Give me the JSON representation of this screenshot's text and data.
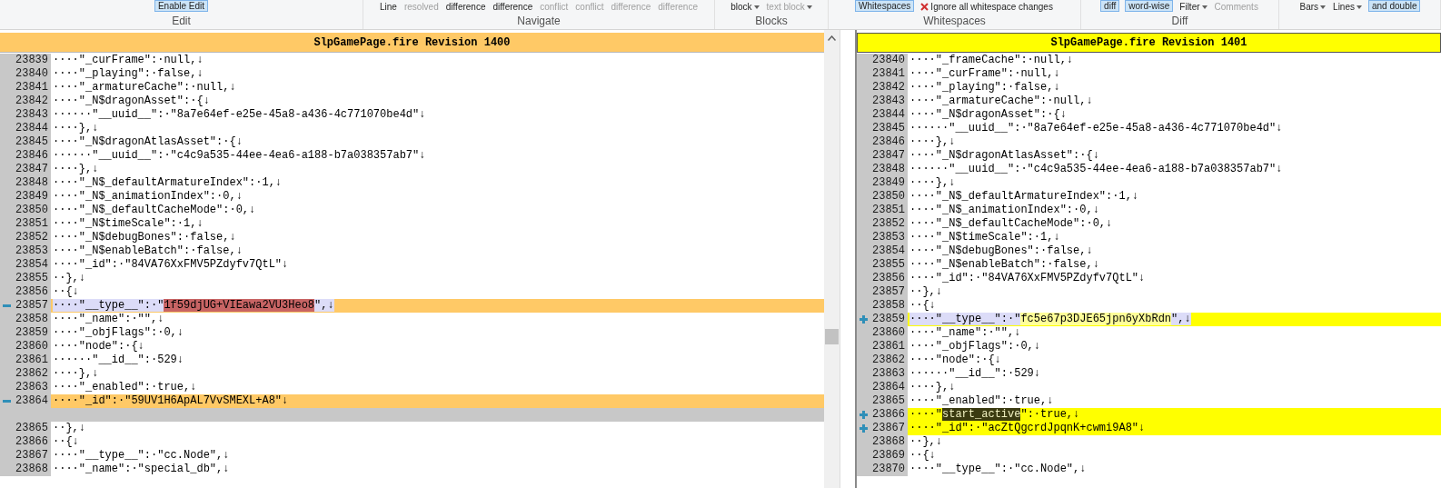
{
  "ribbon": {
    "groups": [
      {
        "label": "Edit",
        "items": [
          {
            "label": "Enable Edit",
            "kind": "button",
            "selected": true,
            "disabled": false
          }
        ]
      },
      {
        "label": "Navigate",
        "items": [
          {
            "label": "Line",
            "kind": "text",
            "selected": false,
            "disabled": false
          },
          {
            "label": "resolved",
            "kind": "text",
            "selected": false,
            "disabled": true
          },
          {
            "label": "difference",
            "kind": "text",
            "selected": false,
            "disabled": false
          },
          {
            "label": "difference",
            "kind": "text",
            "selected": false,
            "disabled": false
          },
          {
            "label": "conflict",
            "kind": "text",
            "selected": false,
            "disabled": true
          },
          {
            "label": "conflict",
            "kind": "text",
            "selected": false,
            "disabled": true
          },
          {
            "label": "difference",
            "kind": "text",
            "selected": false,
            "disabled": true
          },
          {
            "label": "difference",
            "kind": "text",
            "selected": false,
            "disabled": true
          }
        ]
      },
      {
        "label": "Blocks",
        "items": [
          {
            "label": "block",
            "kind": "dropdown",
            "selected": false,
            "disabled": false
          },
          {
            "label": "text block",
            "kind": "dropdown",
            "selected": false,
            "disabled": true
          }
        ]
      },
      {
        "label": "Whitespaces",
        "items": [
          {
            "label": "Whitespaces",
            "kind": "button",
            "selected": true,
            "disabled": false
          },
          {
            "label": "Ignore all whitespace changes",
            "kind": "toggle",
            "selected": false,
            "disabled": false
          }
        ]
      },
      {
        "label": "Diff",
        "items": [
          {
            "label": "diff",
            "kind": "button",
            "selected": true,
            "disabled": false
          },
          {
            "label": "word-wise",
            "kind": "button",
            "selected": true,
            "disabled": false
          },
          {
            "label": "Filter",
            "kind": "dropdown",
            "selected": false,
            "disabled": false
          },
          {
            "label": "Comments",
            "kind": "text",
            "selected": false,
            "disabled": true
          }
        ]
      },
      {
        "items": [
          {
            "label": "Bars",
            "kind": "dropdown",
            "selected": false,
            "disabled": false
          },
          {
            "label": "Lines",
            "kind": "dropdown",
            "selected": false,
            "disabled": false
          },
          {
            "label": "and double",
            "kind": "button",
            "selected": true,
            "disabled": false
          }
        ]
      }
    ]
  },
  "panes": [
    {
      "title": "SlpGamePage.fire Revision 1400",
      "lines": [
        {
          "num": "23839",
          "kind": "normal",
          "segments": [
            {
              "text": "····\"_curFrame\":·null,↓",
              "kind": "plain"
            }
          ]
        },
        {
          "num": "23840",
          "kind": "normal",
          "segments": [
            {
              "text": "····\"_playing\":·false,↓",
              "kind": "plain"
            }
          ]
        },
        {
          "num": "23841",
          "kind": "normal",
          "segments": [
            {
              "text": "····\"_armatureCache\":·null,↓",
              "kind": "plain"
            }
          ]
        },
        {
          "num": "23842",
          "kind": "normal",
          "segments": [
            {
              "text": "····\"_N$dragonAsset\":·{↓",
              "kind": "plain"
            }
          ]
        },
        {
          "num": "23843",
          "kind": "normal",
          "segments": [
            {
              "text": "······\"__uuid__\":·\"8a7e64ef-e25e-45a8-a436-4c771070be4d\"↓",
              "kind": "plain"
            }
          ]
        },
        {
          "num": "23844",
          "kind": "normal",
          "segments": [
            {
              "text": "····},↓",
              "kind": "plain"
            }
          ]
        },
        {
          "num": "23845",
          "kind": "normal",
          "segments": [
            {
              "text": "····\"_N$dragonAtlasAsset\":·{↓",
              "kind": "plain"
            }
          ]
        },
        {
          "num": "23846",
          "kind": "normal",
          "segments": [
            {
              "text": "······\"__uuid__\":·\"c4c9a535-44ee-4ea6-a188-b7a038357ab7\"↓",
              "kind": "plain"
            }
          ]
        },
        {
          "num": "23847",
          "kind": "normal",
          "segments": [
            {
              "text": "····},↓",
              "kind": "plain"
            }
          ]
        },
        {
          "num": "23848",
          "kind": "normal",
          "segments": [
            {
              "text": "····\"_N$_defaultArmatureIndex\":·1,↓",
              "kind": "plain"
            }
          ]
        },
        {
          "num": "23849",
          "kind": "normal",
          "segments": [
            {
              "text": "····\"_N$_animationIndex\":·0,↓",
              "kind": "plain"
            }
          ]
        },
        {
          "num": "23850",
          "kind": "normal",
          "segments": [
            {
              "text": "····\"_N$_defaultCacheMode\":·0,↓",
              "kind": "plain"
            }
          ]
        },
        {
          "num": "23851",
          "kind": "normal",
          "segments": [
            {
              "text": "····\"_N$timeScale\":·1,↓",
              "kind": "plain"
            }
          ]
        },
        {
          "num": "23852",
          "kind": "normal",
          "segments": [
            {
              "text": "····\"_N$debugBones\":·false,↓",
              "kind": "plain"
            }
          ]
        },
        {
          "num": "23853",
          "kind": "normal",
          "segments": [
            {
              "text": "····\"_N$enableBatch\":·false,↓",
              "kind": "plain"
            }
          ]
        },
        {
          "num": "23854",
          "kind": "normal",
          "segments": [
            {
              "text": "····\"_id\":·\"84VA76XxFMV5PZdyfv7QtL\"↓",
              "kind": "plain"
            }
          ]
        },
        {
          "num": "23855",
          "kind": "normal",
          "segments": [
            {
              "text": "··},↓",
              "kind": "plain"
            }
          ]
        },
        {
          "num": "23856",
          "kind": "normal",
          "segments": [
            {
              "text": "··{↓",
              "kind": "plain"
            }
          ]
        },
        {
          "num": "23857",
          "kind": "removed",
          "segments": [
            {
              "text": "····\"__type__\":·\"",
              "kind": "moved"
            },
            {
              "text": "1f59djUG+VIEawa2VU3Heo8",
              "kind": "changed"
            },
            {
              "text": "\",↓",
              "kind": "moved"
            }
          ]
        },
        {
          "num": "23858",
          "kind": "normal",
          "segments": [
            {
              "text": "····\"_name\":·\"\",↓",
              "kind": "plain"
            }
          ]
        },
        {
          "num": "23859",
          "kind": "normal",
          "segments": [
            {
              "text": "····\"_objFlags\":·0,↓",
              "kind": "plain"
            }
          ]
        },
        {
          "num": "23860",
          "kind": "normal",
          "segments": [
            {
              "text": "····\"node\":·{↓",
              "kind": "plain"
            }
          ]
        },
        {
          "num": "23861",
          "kind": "normal",
          "segments": [
            {
              "text": "······\"__id__\":·529↓",
              "kind": "plain"
            }
          ]
        },
        {
          "num": "23862",
          "kind": "normal",
          "segments": [
            {
              "text": "····},↓",
              "kind": "plain"
            }
          ]
        },
        {
          "num": "23863",
          "kind": "normal",
          "segments": [
            {
              "text": "····\"_enabled\":·true,↓",
              "kind": "plain"
            }
          ]
        },
        {
          "num": "23864",
          "kind": "removed",
          "segments": [
            {
              "text": "····\"_id\":·\"59UV1H6ApAL7VvSMEXL+A8\"↓",
              "kind": "plain"
            }
          ]
        },
        {
          "kind": "filler"
        },
        {
          "num": "23865",
          "kind": "normal",
          "segments": [
            {
              "text": "··},↓",
              "kind": "plain"
            }
          ]
        },
        {
          "num": "23866",
          "kind": "normal",
          "segments": [
            {
              "text": "··{↓",
              "kind": "plain"
            }
          ]
        },
        {
          "num": "23867",
          "kind": "normal",
          "segments": [
            {
              "text": "····\"__type__\":·\"cc.Node\",↓",
              "kind": "plain"
            }
          ]
        },
        {
          "num": "23868",
          "kind": "normal",
          "segments": [
            {
              "text": "····\"_name\":·\"special_db\",↓",
              "kind": "plain"
            }
          ]
        }
      ]
    },
    {
      "title": "SlpGamePage.fire Revision 1401",
      "lines": [
        {
          "num": "23840",
          "kind": "normal",
          "segments": [
            {
              "text": "····\"_frameCache\":·null,↓",
              "kind": "plain"
            }
          ]
        },
        {
          "num": "23841",
          "kind": "normal",
          "segments": [
            {
              "text": "····\"_curFrame\":·null,↓",
              "kind": "plain"
            }
          ]
        },
        {
          "num": "23842",
          "kind": "normal",
          "segments": [
            {
              "text": "····\"_playing\":·false,↓",
              "kind": "plain"
            }
          ]
        },
        {
          "num": "23843",
          "kind": "normal",
          "segments": [
            {
              "text": "····\"_armatureCache\":·null,↓",
              "kind": "plain"
            }
          ]
        },
        {
          "num": "23844",
          "kind": "normal",
          "segments": [
            {
              "text": "····\"_N$dragonAsset\":·{↓",
              "kind": "plain"
            }
          ]
        },
        {
          "num": "23845",
          "kind": "normal",
          "segments": [
            {
              "text": "······\"__uuid__\":·\"8a7e64ef-e25e-45a8-a436-4c771070be4d\"↓",
              "kind": "plain"
            }
          ]
        },
        {
          "num": "23846",
          "kind": "normal",
          "segments": [
            {
              "text": "····},↓",
              "kind": "plain"
            }
          ]
        },
        {
          "num": "23847",
          "kind": "normal",
          "segments": [
            {
              "text": "····\"_N$dragonAtlasAsset\":·{↓",
              "kind": "plain"
            }
          ]
        },
        {
          "num": "23848",
          "kind": "normal",
          "segments": [
            {
              "text": "······\"__uuid__\":·\"c4c9a535-44ee-4ea6-a188-b7a038357ab7\"↓",
              "kind": "plain"
            }
          ]
        },
        {
          "num": "23849",
          "kind": "normal",
          "segments": [
            {
              "text": "····},↓",
              "kind": "plain"
            }
          ]
        },
        {
          "num": "23850",
          "kind": "normal",
          "segments": [
            {
              "text": "····\"_N$_defaultArmatureIndex\":·1,↓",
              "kind": "plain"
            }
          ]
        },
        {
          "num": "23851",
          "kind": "normal",
          "segments": [
            {
              "text": "····\"_N$_animationIndex\":·0,↓",
              "kind": "plain"
            }
          ]
        },
        {
          "num": "23852",
          "kind": "normal",
          "segments": [
            {
              "text": "····\"_N$_defaultCacheMode\":·0,↓",
              "kind": "plain"
            }
          ]
        },
        {
          "num": "23853",
          "kind": "normal",
          "segments": [
            {
              "text": "····\"_N$timeScale\":·1,↓",
              "kind": "plain"
            }
          ]
        },
        {
          "num": "23854",
          "kind": "normal",
          "segments": [
            {
              "text": "····\"_N$debugBones\":·false,↓",
              "kind": "plain"
            }
          ]
        },
        {
          "num": "23855",
          "kind": "normal",
          "segments": [
            {
              "text": "····\"_N$enableBatch\":·false,↓",
              "kind": "plain"
            }
          ]
        },
        {
          "num": "23856",
          "kind": "normal",
          "segments": [
            {
              "text": "····\"_id\":·\"84VA76XxFMV5PZdyfv7QtL\"↓",
              "kind": "plain"
            }
          ]
        },
        {
          "num": "23857",
          "kind": "normal",
          "segments": [
            {
              "text": "··},↓",
              "kind": "plain"
            }
          ]
        },
        {
          "num": "23858",
          "kind": "normal",
          "segments": [
            {
              "text": "··{↓",
              "kind": "plain"
            }
          ]
        },
        {
          "num": "23859",
          "kind": "added",
          "segments": [
            {
              "text": "····\"__type__\":·\"",
              "kind": "moved"
            },
            {
              "text": "fc5e67p3DJE65jpn6yXbRdn",
              "kind": "changed"
            },
            {
              "text": "\",↓",
              "kind": "moved"
            }
          ]
        },
        {
          "num": "23860",
          "kind": "normal",
          "segments": [
            {
              "text": "····\"_name\":·\"\",↓",
              "kind": "plain"
            }
          ]
        },
        {
          "num": "23861",
          "kind": "normal",
          "segments": [
            {
              "text": "····\"_objFlags\":·0,↓",
              "kind": "plain"
            }
          ]
        },
        {
          "num": "23862",
          "kind": "normal",
          "segments": [
            {
              "text": "····\"node\":·{↓",
              "kind": "plain"
            }
          ]
        },
        {
          "num": "23863",
          "kind": "normal",
          "segments": [
            {
              "text": "······\"__id__\":·529↓",
              "kind": "plain"
            }
          ]
        },
        {
          "num": "23864",
          "kind": "normal",
          "segments": [
            {
              "text": "····},↓",
              "kind": "plain"
            }
          ]
        },
        {
          "num": "23865",
          "kind": "normal",
          "segments": [
            {
              "text": "····\"_enabled\":·true,↓",
              "kind": "plain"
            }
          ]
        },
        {
          "num": "23866",
          "kind": "added",
          "segments": [
            {
              "text": "····\"",
              "kind": "plain"
            },
            {
              "text": "start_active",
              "kind": "selection"
            },
            {
              "text": "\":·true,↓",
              "kind": "plain"
            }
          ]
        },
        {
          "num": "23867",
          "kind": "added",
          "segments": [
            {
              "text": "····\"_id\":·\"acZtQgcrdJpqnK+cwmi9A8\"↓",
              "kind": "plain"
            }
          ]
        },
        {
          "num": "23868",
          "kind": "normal",
          "segments": [
            {
              "text": "··},↓",
              "kind": "plain"
            }
          ]
        },
        {
          "num": "23869",
          "kind": "normal",
          "segments": [
            {
              "text": "··{↓",
              "kind": "plain"
            }
          ]
        },
        {
          "num": "23870",
          "kind": "normal",
          "segments": [
            {
              "text": "····\"__type__\":·\"cc.Node\",↓",
              "kind": "plain"
            }
          ]
        }
      ]
    }
  ]
}
